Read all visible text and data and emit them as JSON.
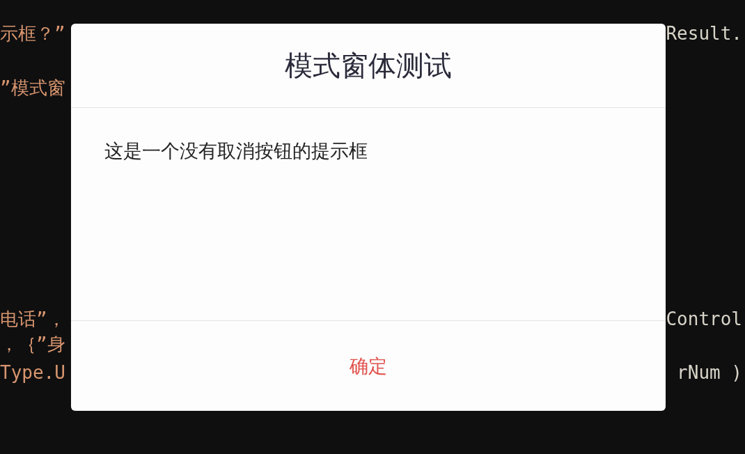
{
  "background_code": [
    {
      "left": "示框？”",
      "right": "Result."
    },
    {
      "left": "”模式窗"
    },
    {
      "left": "电话”，",
      "right": "Control"
    },
    {
      "left": "，｛”身"
    },
    {
      "left": "Type.U",
      "right": "rNum )"
    }
  ],
  "dialog": {
    "title": "模式窗体测试",
    "message": "这是一个没有取消按钮的提示框",
    "buttons": [
      "确定"
    ]
  }
}
